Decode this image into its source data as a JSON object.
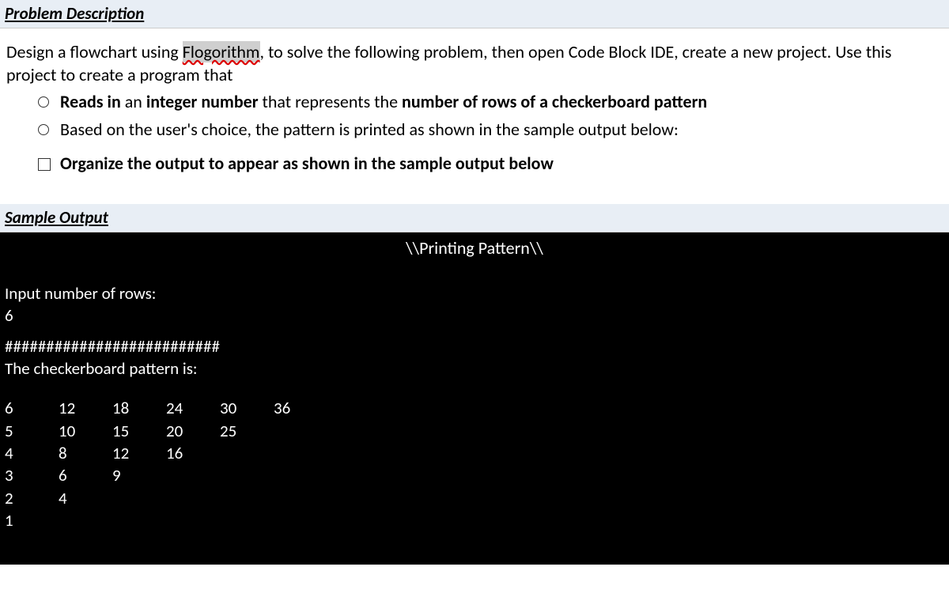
{
  "headers": {
    "problem": "Problem Description",
    "sample": "Sample Output"
  },
  "paragraph": {
    "part1": "Design a flowchart using ",
    "flogorithm": "Flogorithm",
    "part2": ", to solve the following problem, then open Code Block IDE, create a new project. Use this project to create a program that"
  },
  "bullets": {
    "b1_pre": "Reads in",
    "b1_mid1": " an ",
    "b1_bold1": "integer number",
    "b1_mid2": " that represents the ",
    "b1_bold2": "number of",
    "b1_post": " rows of a checkerboard pattern",
    "b2": "Based on the user's choice, the pattern is printed as shown in the sample output below:",
    "b3": "Organize the output to appear as shown in the sample output below"
  },
  "console": {
    "title": "\\\\Printing Pattern\\\\",
    "prompt": "Input number of rows:",
    "input": "6",
    "sep": "##########################",
    "label": "The checkerboard pattern is:"
  },
  "chart_data": {
    "type": "table",
    "title": "Checkerboard multiplication pattern",
    "rows": [
      [
        6,
        12,
        18,
        24,
        30,
        36
      ],
      [
        5,
        10,
        15,
        20,
        25
      ],
      [
        4,
        8,
        12,
        16
      ],
      [
        3,
        6,
        9
      ],
      [
        2,
        4
      ],
      [
        1
      ]
    ]
  }
}
